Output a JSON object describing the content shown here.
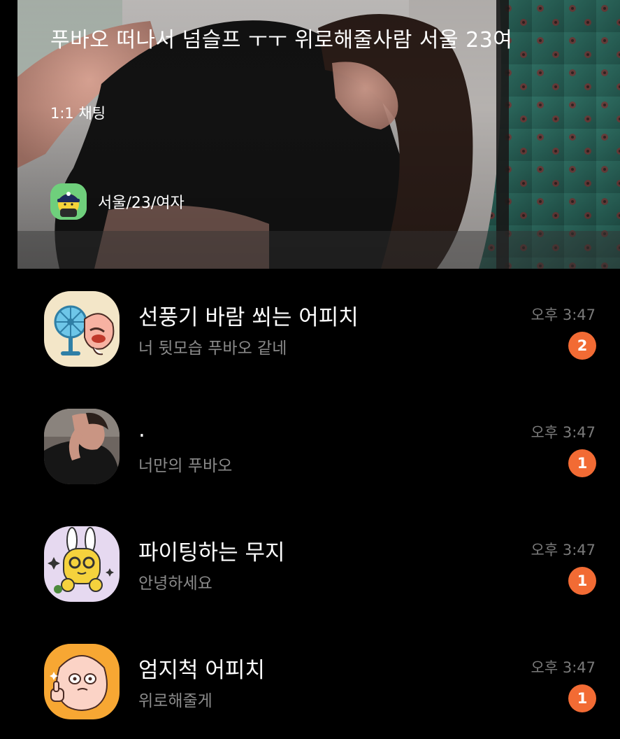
{
  "banner": {
    "title": "푸바오 떠나서 넘슬프 ㅜㅜ 위로해줄사람 서울 23여",
    "type": "1:1 채팅",
    "profile_name": "서울/23/여자"
  },
  "chats": [
    {
      "name": "선풍기 바람 쐬는 어피치",
      "preview": "너 뒷모습 푸바오 같네",
      "time": "오후 3:47",
      "unread": "2",
      "avatar_icon": "apeach-fan-icon"
    },
    {
      "name": ".",
      "preview": "너만의 푸바오",
      "time": "오후 3:47",
      "unread": "1",
      "avatar_icon": "photo-avatar-icon"
    },
    {
      "name": "파이팅하는 무지",
      "preview": "안녕하세요",
      "time": "오후 3:47",
      "unread": "1",
      "avatar_icon": "muzi-fighting-icon"
    },
    {
      "name": "엄지척 어피치",
      "preview": "위로해줄게",
      "time": "오후 3:47",
      "unread": "1",
      "avatar_icon": "apeach-thumbsup-icon"
    }
  ],
  "colors": {
    "background": "#000000",
    "badge": "#f26b34",
    "preview_text": "#8a8a8a",
    "time_text": "#7a7a7a"
  }
}
